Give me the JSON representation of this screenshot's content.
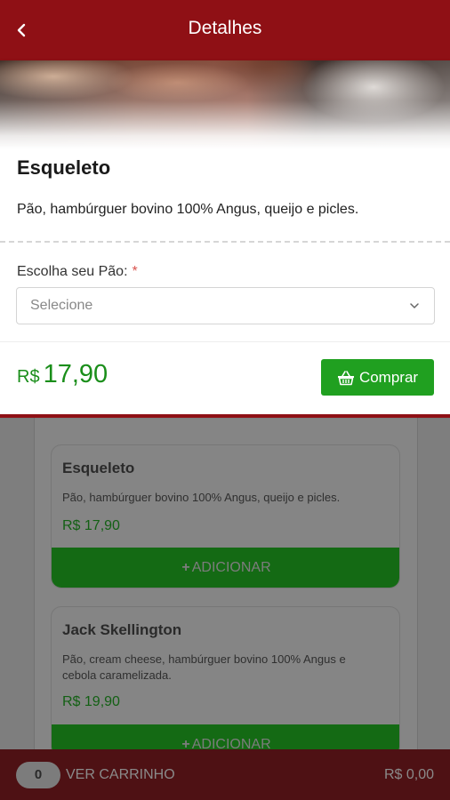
{
  "header": {
    "title": "Detalhes"
  },
  "detail": {
    "name": "Esqueleto",
    "description": "Pão, hambúrguer bovino 100% Angus, queijo e picles.",
    "field_label": "Escolha seu Pão:",
    "required_mark": "*",
    "select_placeholder": "Selecione",
    "price_currency": "R$",
    "price_value": "17,90",
    "buy_label": "Comprar"
  },
  "products": [
    {
      "name": "Esqueleto",
      "description": "Pão, hambúrguer bovino 100% Angus, queijo e picles.",
      "price": "R$ 17,90",
      "button_label": "ADICIONAR"
    },
    {
      "name": "Jack Skellington",
      "description": "Pão, cream cheese, hambúrguer bovino 100% Angus e cebola caramelizada.",
      "price": "R$ 19,90",
      "button_label": "ADICIONAR"
    }
  ],
  "cart": {
    "count": "0",
    "label": "VER CARRINHO",
    "total": "R$ 0,00"
  },
  "colors": {
    "brand": "#8f1015",
    "accent_green": "#20a020",
    "price_green": "#1a8e1a"
  },
  "icons": {
    "back": "chevron-left-icon",
    "caret": "chevron-down-icon",
    "cart": "shopping-basket-icon",
    "plus": "plus-icon"
  }
}
